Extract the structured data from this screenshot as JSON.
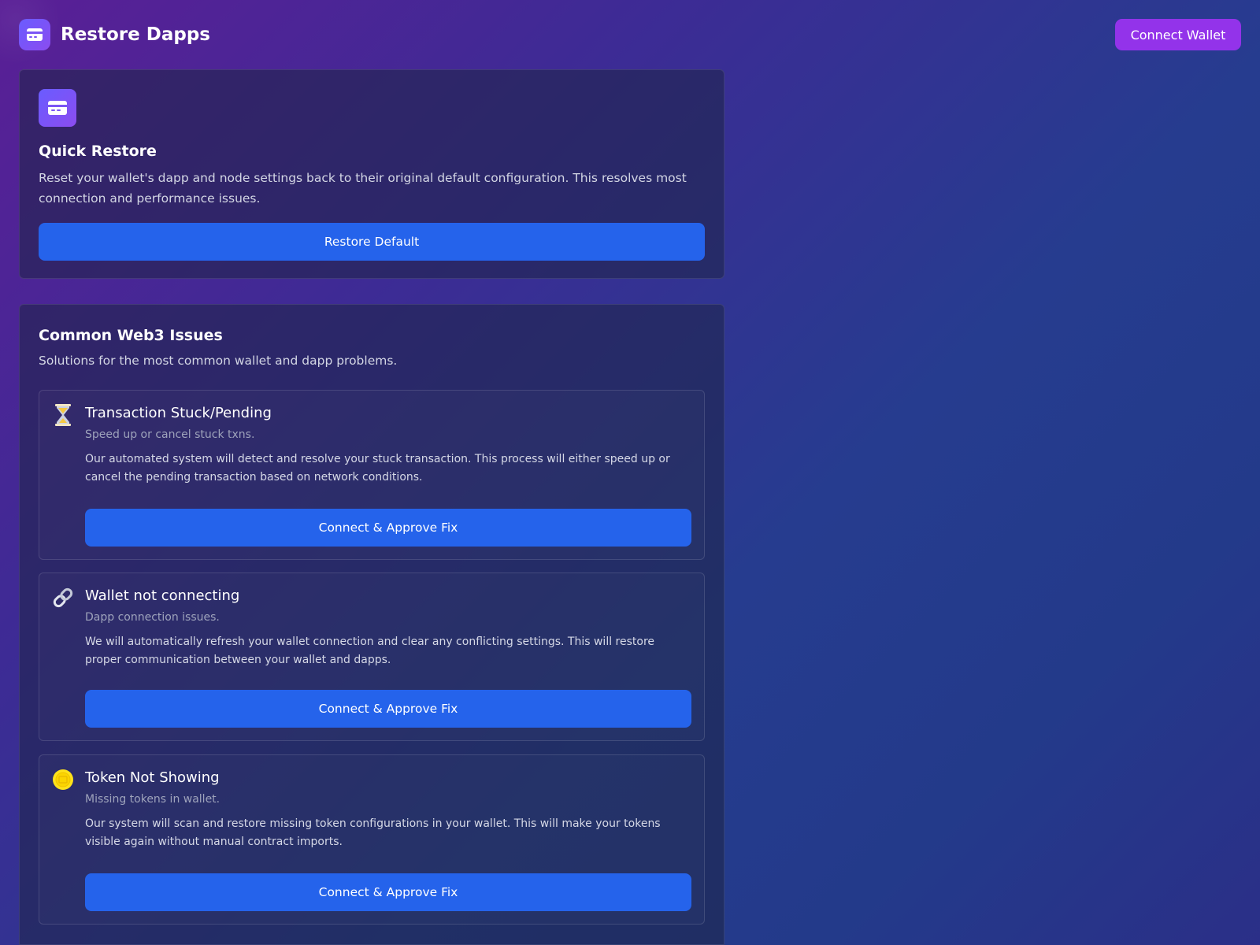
{
  "header": {
    "title": "Restore Dapps",
    "logo_icon": "card-icon",
    "connect_label": "Connect Wallet"
  },
  "quick_restore": {
    "icon": "card-icon",
    "title": "Quick Restore",
    "description": "Reset your wallet's dapp and node settings back to their original default configuration. This resolves most connection and performance issues.",
    "button_label": "Restore Default"
  },
  "issues": {
    "title": "Common Web3 Issues",
    "subtitle": "Solutions for the most common wallet and dapp problems.",
    "items": [
      {
        "icon": "hourglass-icon",
        "title": "Transaction Stuck/Pending",
        "subtitle": "Speed up or cancel stuck txns.",
        "description": "Our automated system will detect and resolve your stuck transaction. This process will either speed up or cancel the pending transaction based on network conditions.",
        "button_label": "Connect & Approve Fix"
      },
      {
        "icon": "link-icon",
        "title": "Wallet not connecting",
        "subtitle": "Dapp connection issues.",
        "description": "We will automatically refresh your wallet connection and clear any conflicting settings. This will restore proper communication between your wallet and dapps.",
        "button_label": "Connect & Approve Fix"
      },
      {
        "icon": "coin-icon",
        "title": "Token Not Showing",
        "subtitle": "Missing tokens in wallet.",
        "description": "Our system will scan and restore missing token configurations in your wallet. This will make your tokens visible again without manual contract imports.",
        "button_label": "Connect & Approve Fix"
      }
    ]
  },
  "colors": {
    "accent_purple": "#9333ea",
    "button_blue": "#2563eb",
    "icon_gradient_start": "#6a5cff",
    "icon_gradient_end": "#8b4cf0"
  }
}
